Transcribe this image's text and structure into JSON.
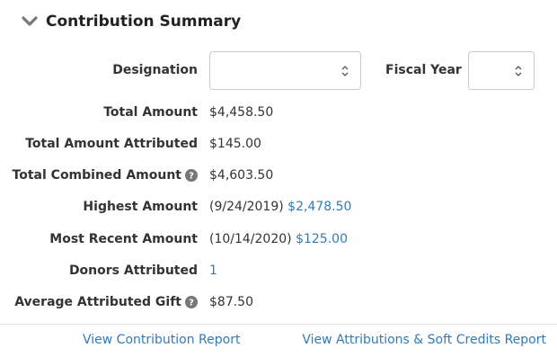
{
  "header": {
    "title": "Contribution Summary",
    "toggle_icon": "chevron-down-icon"
  },
  "filters": {
    "designation_label": "Designation",
    "designation_value": "",
    "fiscal_year_label": "Fiscal Year",
    "fiscal_year_value": ""
  },
  "summary": {
    "total_amount": {
      "label": "Total Amount",
      "value": "$4,458.50"
    },
    "total_amount_attributed": {
      "label": "Total Amount Attributed",
      "value": "$145.00"
    },
    "total_combined_amount": {
      "label": "Total Combined Amount",
      "value": "$4,603.50",
      "icon": "question-circle-icon"
    },
    "highest_amount": {
      "label": "Highest Amount",
      "date": "(9/24/2019)",
      "value": "$2,478.50"
    },
    "most_recent_amount": {
      "label": "Most Recent Amount",
      "date": "(10/14/2020)",
      "value": "$125.00"
    },
    "donors_attributed": {
      "label": "Donors Attributed",
      "value": "1"
    },
    "average_attributed_gift": {
      "label": "Average Attributed Gift",
      "value": "$87.50",
      "icon": "question-circle-icon"
    }
  },
  "footer": {
    "contribution_report_link": "View Contribution Report",
    "attributions_report_link": "View Attributions & Soft Credits Report"
  },
  "colors": {
    "link": "#337ab7",
    "text": "#333333",
    "border": "#cccccc"
  }
}
